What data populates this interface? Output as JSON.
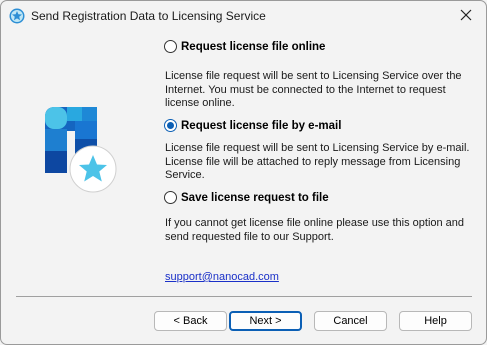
{
  "window": {
    "title": "Send Registration Data to Licensing Service"
  },
  "options": [
    {
      "label": "Request license file online",
      "selected": false,
      "description": [
        "License file request will be sent to Licensing Service over the",
        "Internet. You must be connected to the Internet to request",
        "license online."
      ]
    },
    {
      "label": "Request license file by e-mail",
      "selected": true,
      "description": [
        "License file request will be sent to Licensing Service by e-mail.",
        "License file will be attached to reply message from Licensing",
        "Service."
      ]
    },
    {
      "label": "Save license request to file",
      "selected": false,
      "description": [
        "If you cannot get license file online please use this option and",
        "send requested file to our Support."
      ]
    }
  ],
  "support_link": "support@nanocad.com",
  "buttons": {
    "back": "< Back",
    "next": "Next >",
    "cancel": "Cancel",
    "help": "Help"
  },
  "colors": {
    "accent": "#0b5fb5",
    "link": "#1a30c8",
    "logo_light": "#4cc3e8",
    "logo_dark": "#1565c0"
  },
  "icons": {
    "app": "star-badge-icon",
    "close": "close-icon",
    "logo": "licensing-logo"
  }
}
